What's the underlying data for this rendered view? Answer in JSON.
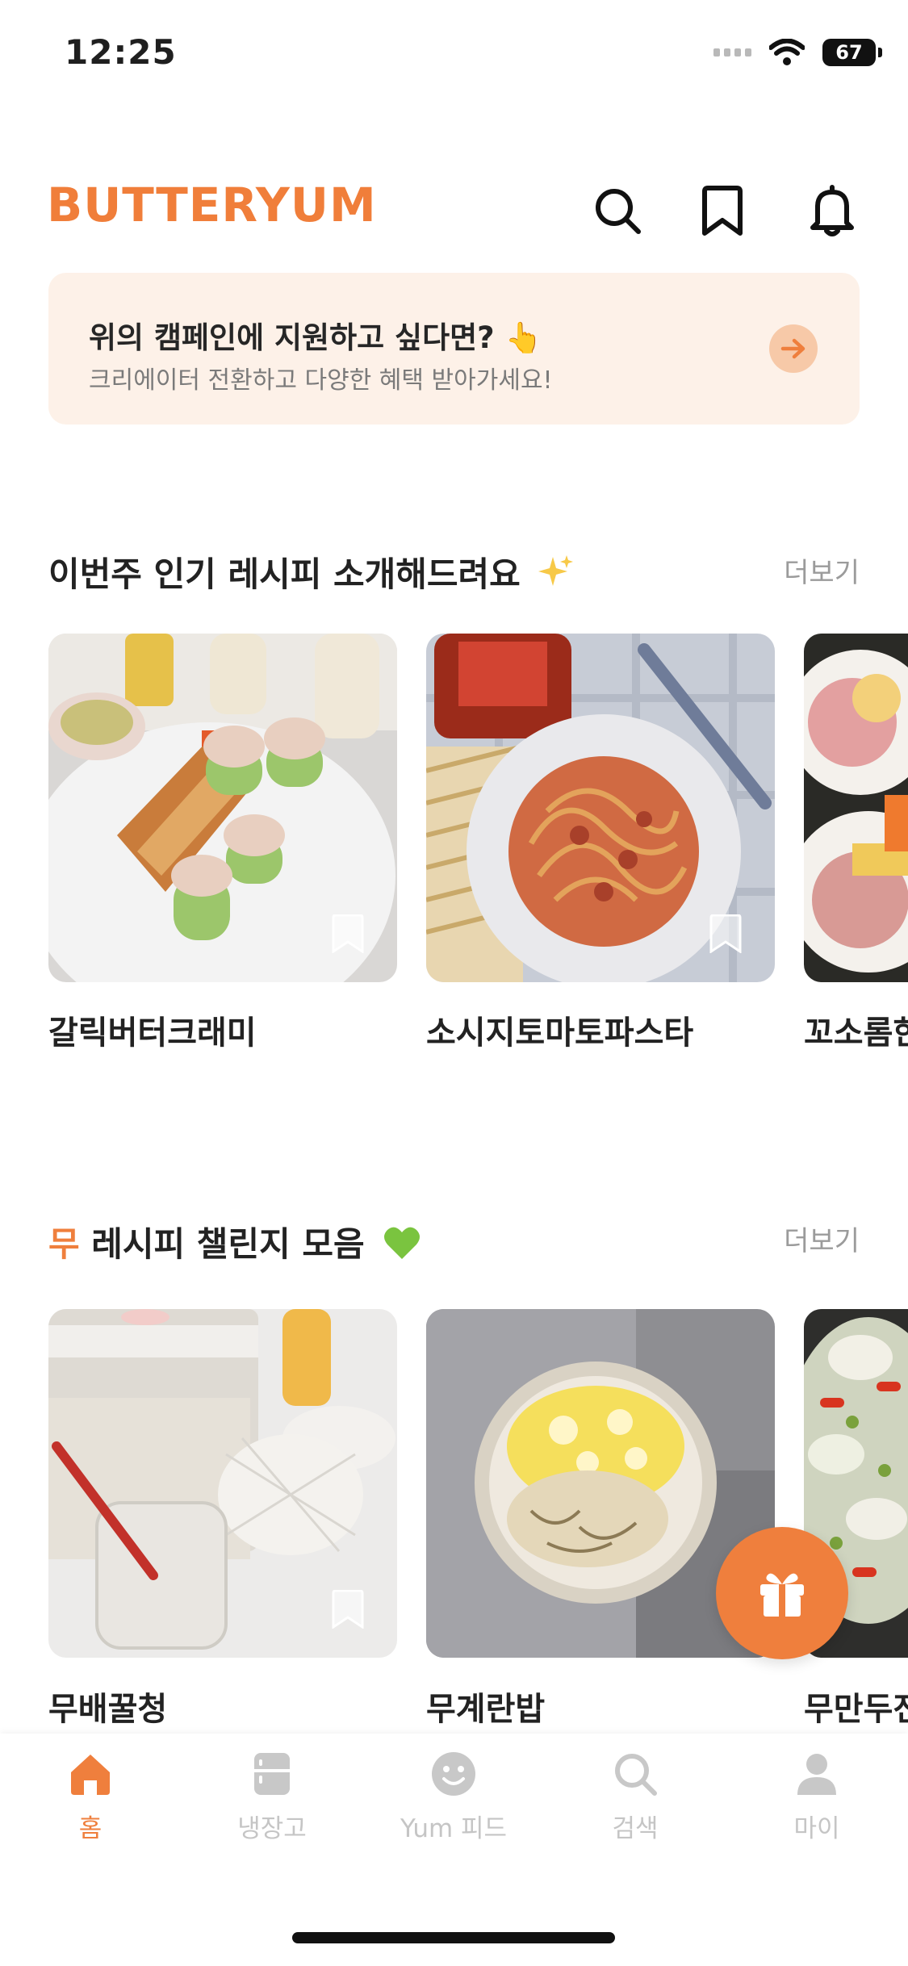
{
  "status": {
    "time": "12:25",
    "battery": "67"
  },
  "header": {
    "logo": "BUTTERYUM"
  },
  "banner": {
    "title": "위의 캠페인에 지원하고 싶다면? 👆",
    "subtitle": "크리에이터 전환하고 다양한 혜택 받아가세요!"
  },
  "section1": {
    "title": "이번주 인기 레시피 소개해드려요",
    "more": "더보기",
    "cards": [
      {
        "label": "갈릭버터크래미"
      },
      {
        "label": "소시지토마토파스타"
      },
      {
        "label": "꼬소롬한"
      }
    ]
  },
  "section2": {
    "title_accent": "무",
    "title_rest": " 레시피 챌린지 모음",
    "more": "더보기",
    "cards": [
      {
        "label": "무배꿀청"
      },
      {
        "label": "무계란밥"
      },
      {
        "label": "무만두전"
      }
    ]
  },
  "tabs": [
    {
      "label": "홈",
      "icon": "home-icon",
      "active": true
    },
    {
      "label": "냉장고",
      "icon": "fridge-icon",
      "active": false
    },
    {
      "label": "Yum 피드",
      "icon": "smile-icon",
      "active": false
    },
    {
      "label": "검색",
      "icon": "search-icon",
      "active": false
    },
    {
      "label": "마이",
      "icon": "person-icon",
      "active": false
    }
  ],
  "colors": {
    "brand": "#EF7F3D",
    "banner_bg": "#FDF1E8",
    "inactive": "#C5C5C5"
  }
}
